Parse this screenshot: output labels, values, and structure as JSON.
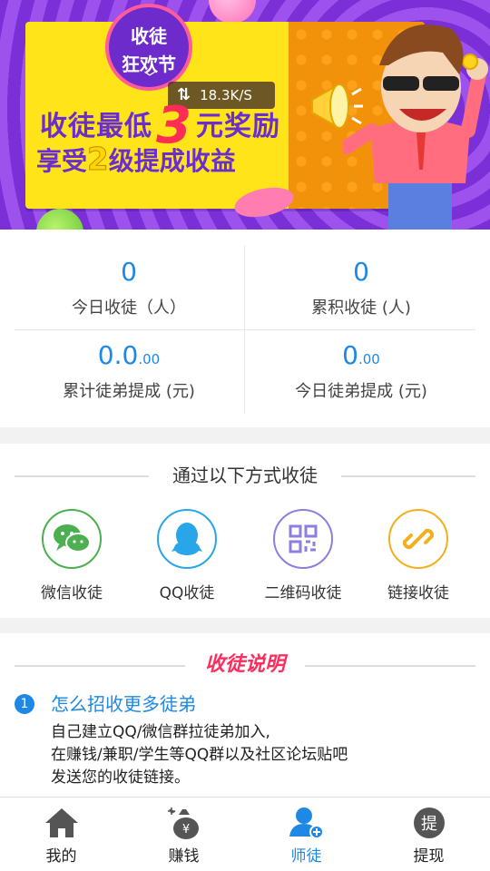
{
  "banner": {
    "badge_line1": "收徒",
    "badge_line2": "狂欢节",
    "speed": "18.3K/S",
    "headline_pre": "收徒最低",
    "headline_num": "3",
    "headline_post": "元奖励",
    "sub_pre": "享受",
    "sub_num": "2",
    "sub_post": "级提成收益"
  },
  "stats": [
    {
      "value": "0",
      "decimal": "",
      "label": "今日收徒（人）"
    },
    {
      "value": "0",
      "decimal": "",
      "label": "累积收徒 (人)"
    },
    {
      "value": "0.0",
      "decimal": ".00",
      "label": "累计徒弟提成 (元)"
    },
    {
      "value": "0",
      "decimal": ".00",
      "label": "今日徒弟提成 (元)"
    }
  ],
  "methods": {
    "title": "通过以下方式收徒",
    "items": [
      {
        "label": "微信收徒",
        "icon": "wechat-icon",
        "color": "#4caf50"
      },
      {
        "label": "QQ收徒",
        "icon": "qq-icon",
        "color": "#29a6e8"
      },
      {
        "label": "二维码收徒",
        "icon": "qrcode-icon",
        "color": "#8f7de0"
      },
      {
        "label": "链接收徒",
        "icon": "link-icon",
        "color": "#f2b01e"
      }
    ]
  },
  "howto": {
    "title": "收徒说明",
    "step_num": "1",
    "step_title": "怎么招收更多徒弟",
    "body_lines": [
      "自己建立QQ/微信群拉徒弟加入,",
      "在赚钱/兼职/学生等QQ群以及社区论坛贴吧",
      "发送您的收徒链接。"
    ]
  },
  "nav": [
    {
      "label": "我的",
      "icon": "home-icon",
      "active": false
    },
    {
      "label": "赚钱",
      "icon": "money-bag-icon",
      "active": false
    },
    {
      "label": "师徒",
      "icon": "add-user-icon",
      "active": true
    },
    {
      "label": "提现",
      "icon": "withdraw-icon",
      "active": false
    }
  ],
  "colors": {
    "accent": "#1e88e5",
    "highlight": "#ff2d5c",
    "banner_purple": "#7b2fd6",
    "banner_yellow": "#ffe41a"
  }
}
